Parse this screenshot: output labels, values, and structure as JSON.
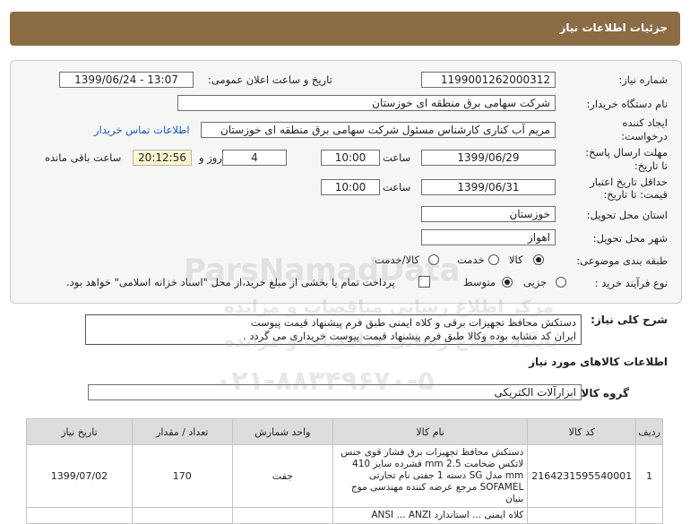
{
  "header": {
    "title": "جزئیات اطلاعات نیاز"
  },
  "form": {
    "need_number_label": "شماره نیاز:",
    "need_number": "1199001262000312",
    "announce_label": "تاریخ و ساعت اعلان عمومی:",
    "announce_value": "1399/06/24 - 13:07",
    "buyer_org_label": "نام دستگاه خریدار:",
    "buyer_org": "شرکت سهامی برق منطقه ای خوزستان",
    "creator_label_line1": "ایجاد کننده",
    "creator_label_line2": "درخواست:",
    "creator": "مریم آب کناری کارشناس مسئول شرکت سهامی برق منطقه ای خوزستان",
    "contact_link": "اطلاعات تماس خریدار",
    "reply_deadline_label_line1": "مهلت ارسال پاسخ:",
    "reply_deadline_label_line2": "تا تاریخ:",
    "reply_date": "1399/06/29",
    "time_label": "ساعت",
    "reply_time": "10:00",
    "days_value": "4",
    "days_label": "روز و",
    "remaining_time": "20:12:56",
    "remaining_label": "ساعت باقی مانده",
    "price_validity_label_line1": "حداقل تاریخ اعتبار",
    "price_validity_label_line2": "قیمت: تا تاریخ:",
    "validity_date": "1399/06/31",
    "validity_time": "10:00",
    "province_label": "استان محل تحویل:",
    "province": "خوزستان",
    "city_label": "شهر محل تحویل:",
    "city": "اهواز",
    "category_label": "طبقه بندی موضوعی:",
    "category_options": [
      "کالا",
      "خدمت",
      "کالا/خدمت"
    ],
    "category_selected": "کالا",
    "process_label": "نوع فرآیند خرید :",
    "process_options": [
      "جزیی",
      "متوسط"
    ],
    "process_selected": "متوسط",
    "payment_note": "پرداخت تمام یا بخشی از مبلغ خرید،از محل \"اسناد خزانه اسلامی\" خواهد بود."
  },
  "description": {
    "label": "شرح کلی نیاز:",
    "line1": "دستکش محافظ تجهیزات برقی و کلاه ایمنی طبق فرم پیشنهاد قیمت پیوست",
    "line2": "ایران کد مشابه بوده وکالا طبق فرم پیشنهاد قیمت پیوست خریداری می گردد ."
  },
  "goods_section": {
    "title": "اطلاعات کالاهای مورد نیاز",
    "group_label": "گروه کالا:",
    "group_value": "ابزارآلات الکتریکی"
  },
  "table": {
    "headers": [
      "ردیف",
      "کد کالا",
      "نام کالا",
      "واحد شمارش",
      "تعداد / مقدار",
      "تاریخ نیاز"
    ],
    "rows": [
      {
        "row": "1",
        "code": "2164231595540001",
        "name": "دستکش محافظ تجهیزات برق فشار قوی جنس لاتکس ضخامت mm 2.5 فشرده سایز 410 mm مدل SG دسته 1 جفتی نام تجارتی SOFAMEL مرجع عرضه کننده مهندسی موج بنیان",
        "unit": "جفت",
        "qty": "170",
        "date": "1399/07/02"
      }
    ],
    "partial_next_row": "کلاه ایمنی ... استاندارد ANSI ... ANZI"
  },
  "watermark": {
    "brand": "ParsNamadData",
    "sub1": "مرکز اطلاع رسانی مناقصات و مزایده",
    "sub2": "پایگاه اطلاع رسانی مناقصات و مزایده",
    "phone": "۰۲۱-۸۸۳۴۹۶۷۰-۵"
  }
}
